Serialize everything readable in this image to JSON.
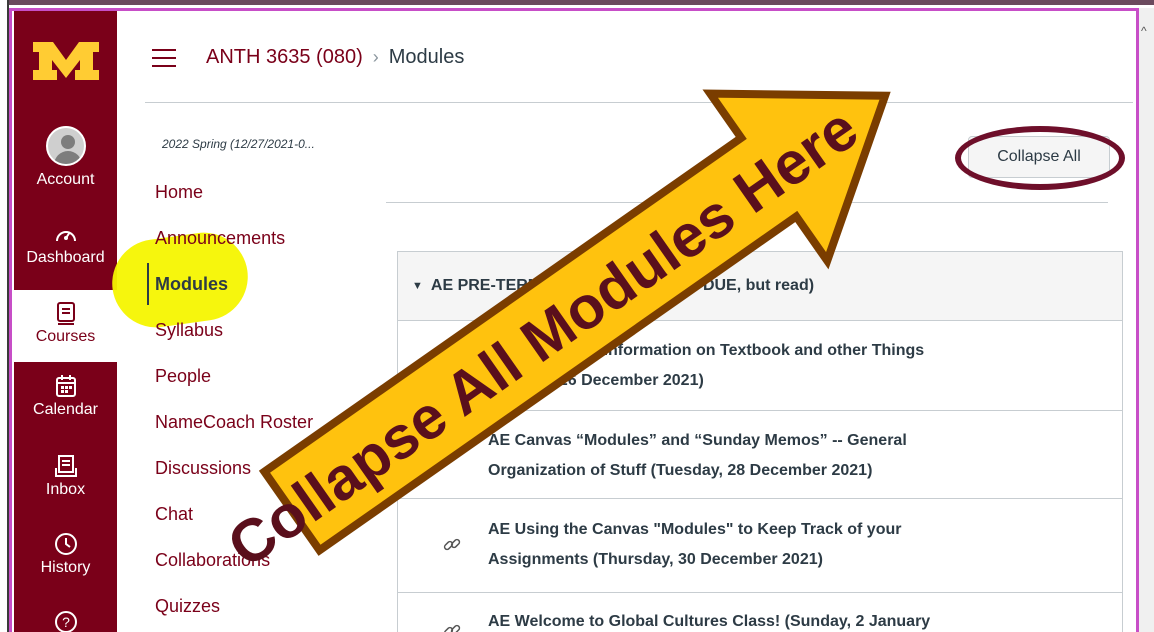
{
  "app": {
    "brand_color": "#7a0019",
    "logo_text": "M"
  },
  "global_nav": {
    "items": [
      {
        "label": "Account",
        "icon": "user-avatar-icon"
      },
      {
        "label": "Dashboard",
        "icon": "dashboard-gauge-icon"
      },
      {
        "label": "Courses",
        "icon": "book-icon",
        "active": true
      },
      {
        "label": "Calendar",
        "icon": "calendar-icon"
      },
      {
        "label": "Inbox",
        "icon": "inbox-icon"
      },
      {
        "label": "History",
        "icon": "clock-icon"
      },
      {
        "label": "",
        "icon": "help-icon"
      }
    ]
  },
  "header": {
    "course": "ANTH 3635 (080)",
    "separator": "›",
    "current": "Modules"
  },
  "course_nav": {
    "term": "2022 Spring (12/27/2021-0...",
    "items": [
      {
        "label": "Home"
      },
      {
        "label": "Announcements"
      },
      {
        "label": "Modules",
        "active": true
      },
      {
        "label": "Syllabus"
      },
      {
        "label": "People"
      },
      {
        "label": "NameCoach Roster"
      },
      {
        "label": "Discussions"
      },
      {
        "label": "Chat"
      },
      {
        "label": "Collaborations"
      },
      {
        "label": "Quizzes"
      }
    ]
  },
  "content": {
    "collapse_all_label": "Collapse All",
    "module": {
      "title": "AE PRE-TERM s2022 MEMOS (NOT DUE, but read)",
      "items": [
        {
          "title_line1": "AE Greetings - Information on Textbook and other Things",
          "title_line2": "(Sunday, 26 December 2021)"
        },
        {
          "title_line1": "AE Canvas “Modules” and “Sunday Memos” -- General",
          "title_line2": "Organization of Stuff (Tuesday, 28 December 2021)"
        },
        {
          "title_line1": "AE Using the Canvas \"Modules\" to Keep Track of your",
          "title_line2": "Assignments (Thursday, 30 December 2021)"
        },
        {
          "title_line1": "AE Welcome to Global Cultures Class! (Sunday, 2 January",
          "title_line2": ""
        }
      ]
    }
  },
  "annotation": {
    "arrow_text": "Collapse All Modules Here",
    "arrow_fill": "#ffc20e",
    "arrow_outline": "#7a3d00",
    "circle_color": "#6e0f2a",
    "highlight_color": "#f6f600"
  }
}
